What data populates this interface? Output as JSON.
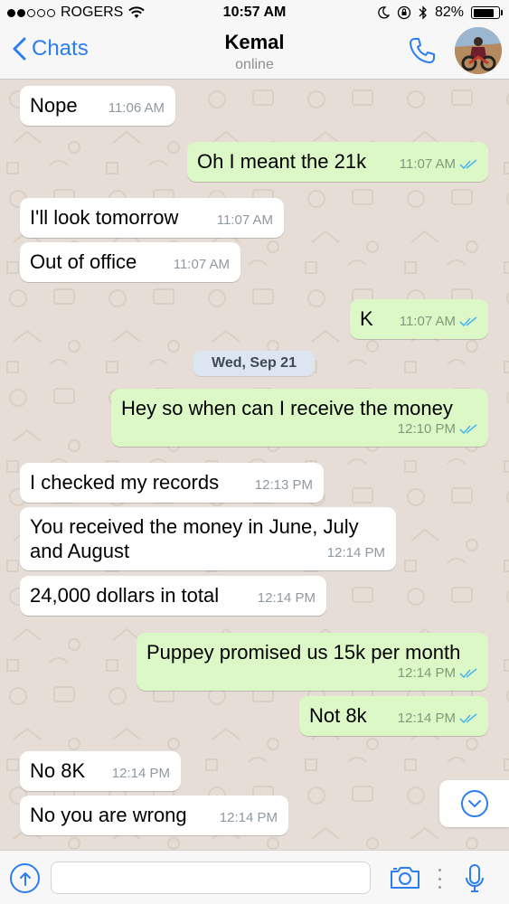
{
  "status_bar": {
    "carrier": "ROGERS",
    "time": "10:57 AM",
    "battery": "82%",
    "battery_level": 0.82,
    "signal_bars": 2
  },
  "nav": {
    "back_label": "Chats",
    "contact_name": "Kemal",
    "contact_status": "online"
  },
  "colors": {
    "accent": "#2b7ef2",
    "incoming_bubble": "#ffffff",
    "outgoing_bubble": "#dcf8c6",
    "chat_background": "#e6ded6",
    "read_ticks": "#4fb6ec"
  },
  "messages": [
    {
      "direction": "in",
      "text": "Nope",
      "time": "11:06 AM"
    },
    {
      "direction": "out",
      "text": "Oh I meant the 21k",
      "time": "11:07 AM",
      "status": "read"
    },
    {
      "direction": "in",
      "text": "I'll look tomorrow",
      "time": "11:07 AM"
    },
    {
      "direction": "in",
      "text": "Out of office",
      "time": "11:07 AM"
    },
    {
      "direction": "out",
      "text": "K",
      "time": "11:07 AM",
      "status": "read"
    },
    {
      "direction": "out",
      "text": "Hey so when can I receive the money",
      "time": "12:10 PM",
      "status": "read"
    },
    {
      "direction": "in",
      "text": "I checked my records",
      "time": "12:13 PM"
    },
    {
      "direction": "in",
      "text": "You received the money in June, July and August",
      "time": "12:14 PM"
    },
    {
      "direction": "in",
      "text": "24,000 dollars in total",
      "time": "12:14 PM"
    },
    {
      "direction": "out",
      "text": "Puppey promised us 15k per month",
      "time": "12:14 PM",
      "status": "read"
    },
    {
      "direction": "out",
      "text": "Not 8k",
      "time": "12:14 PM",
      "status": "read"
    },
    {
      "direction": "in",
      "text": "No 8K",
      "time": "12:14 PM"
    },
    {
      "direction": "in",
      "text": "No you are wrong",
      "time": "12:14 PM"
    }
  ],
  "date_separator": "Wed, Sep 21",
  "input": {
    "value": "",
    "placeholder": ""
  },
  "icons": {
    "back": "chevron-left-icon",
    "call": "phone-icon",
    "scroll_down": "chevron-down-circle-icon",
    "attach": "upload-arrow-icon",
    "camera": "camera-icon",
    "mic": "microphone-icon",
    "read_receipt": "double-check-icon"
  }
}
